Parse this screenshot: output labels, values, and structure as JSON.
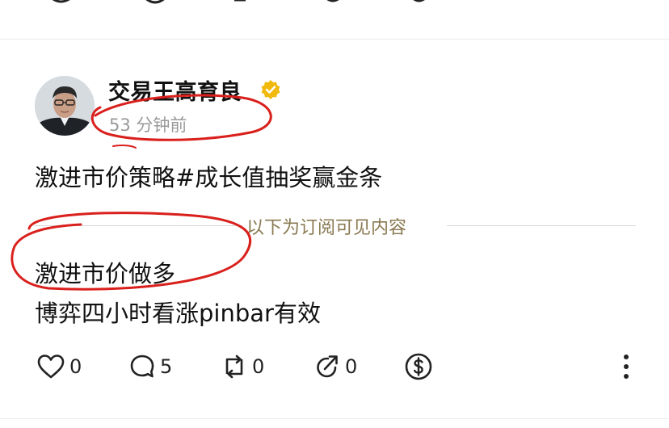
{
  "post": {
    "author": {
      "name": "交易王高育良",
      "verified": true,
      "verified_color": "#f0b90b"
    },
    "time": "53 分钟前",
    "title": "激进市价策略#成长值抽奖赢金条",
    "subscriber_divider": "以下为订阅可见内容",
    "body_lines": [
      "激进市价做多",
      "博弈四小时看涨pinbar有效"
    ],
    "actions": {
      "like": {
        "icon": "heart-icon",
        "count": "0"
      },
      "comment": {
        "icon": "comment-icon",
        "count": "5"
      },
      "repost": {
        "icon": "repost-icon",
        "count": "0"
      },
      "share": {
        "icon": "share-icon",
        "count": "0"
      },
      "tip": {
        "icon": "dollar-icon"
      },
      "more": {
        "icon": "more-vertical-icon"
      }
    }
  },
  "colors": {
    "annotation_red": "#d9201c",
    "muted_text": "#9a9a9a",
    "divider_label": "#8a7a52"
  }
}
